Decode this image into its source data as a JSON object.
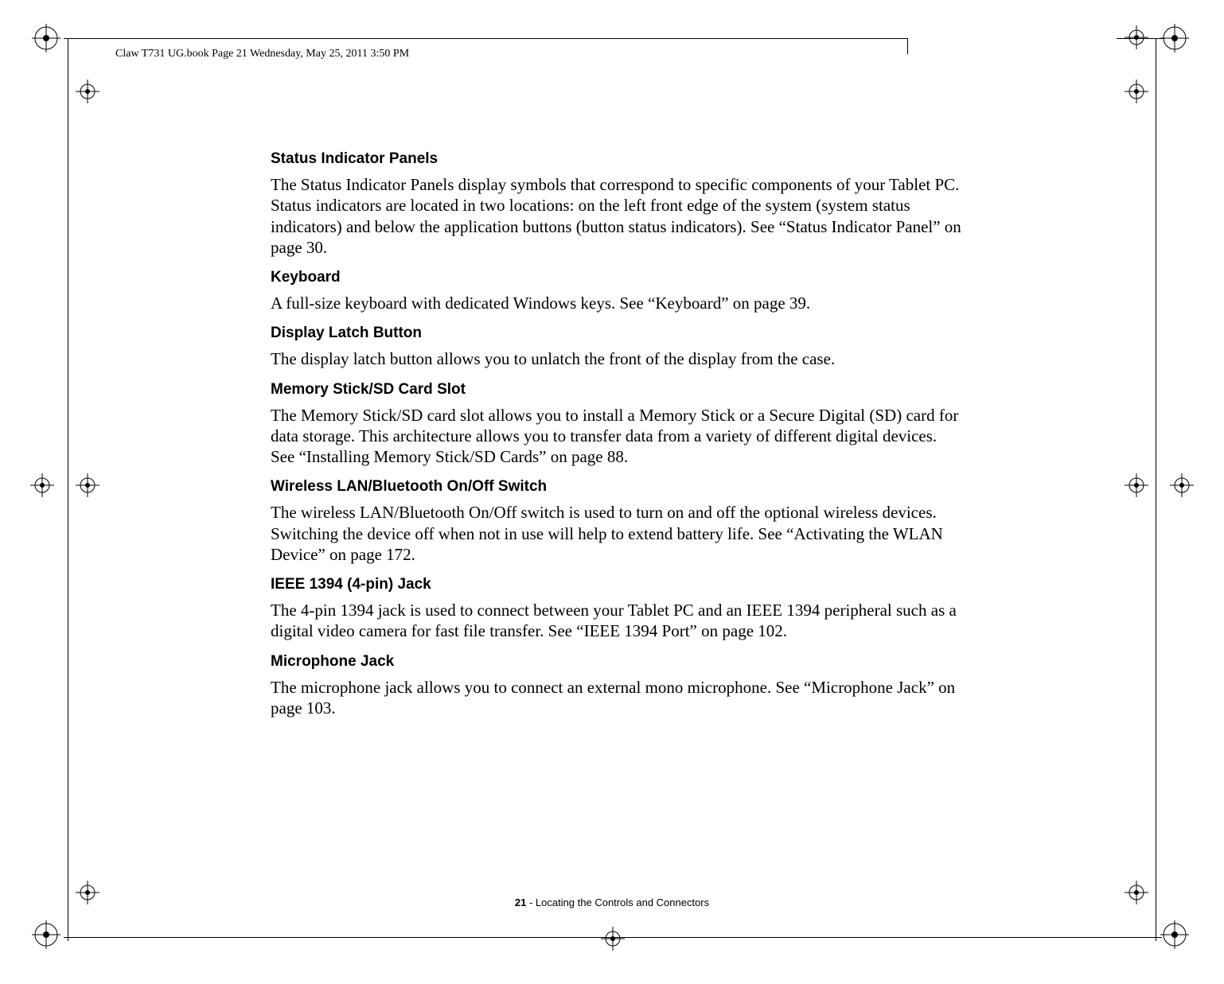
{
  "header": {
    "running_head": "Claw T731 UG.book  Page 21  Wednesday, May 25, 2011  3:50 PM"
  },
  "sections": [
    {
      "heading": "Status Indicator Panels",
      "body": "The Status Indicator Panels display symbols that correspond to specific components of your Tablet PC. Status indicators are located in two locations: on the left front edge of the system (system status indicators) and below the application buttons (button status indicators). See “Status Indicator Panel” on page 30."
    },
    {
      "heading": "Keyboard",
      "body": "A full-size keyboard with dedicated Windows keys. See “Keyboard” on page 39."
    },
    {
      "heading": "Display Latch Button",
      "body": "The display latch button allows you to unlatch the front of the display from the case."
    },
    {
      "heading": "Memory Stick/SD Card Slot",
      "body": "The Memory Stick/SD card slot allows you to install a Memory Stick or a Secure Digital (SD) card for data storage. This architecture allows you to transfer data from a variety of different digital devices. See “Installing Memory Stick/SD Cards” on page 88."
    },
    {
      "heading": "Wireless LAN/Bluetooth On/Off Switch",
      "body": "The wireless LAN/Bluetooth On/Off switch is used to turn on and off the optional wireless devices. Switching the device off when not in use will help to extend battery life. See “Activating the WLAN Device” on page 172."
    },
    {
      "heading": "IEEE 1394 (4-pin) Jack",
      "body": "The 4-pin 1394 jack is used to connect between your Tablet PC and an IEEE 1394 peripheral such as a digital video camera for fast file transfer. See “IEEE 1394 Port” on page 102."
    },
    {
      "heading": "Microphone Jack",
      "body": "The microphone jack allows you to connect an external mono microphone. See “Microphone Jack” on page 103."
    }
  ],
  "footer": {
    "page_number": "21",
    "separator": " - ",
    "chapter": "Locating the Controls and Connectors"
  }
}
